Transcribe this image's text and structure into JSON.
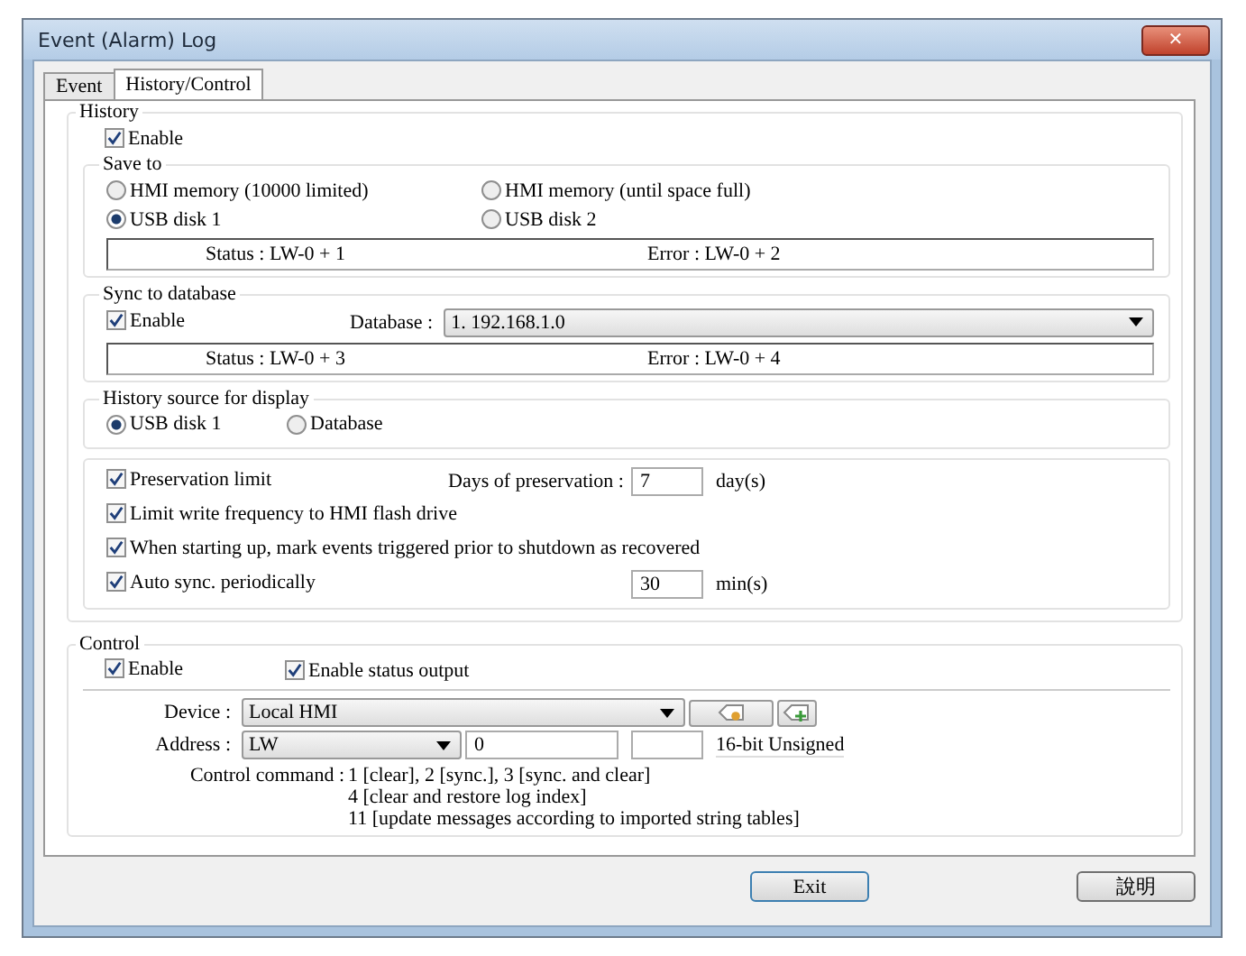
{
  "window": {
    "title": "Event (Alarm) Log",
    "close": "✕"
  },
  "tabs": [
    {
      "label": "Event",
      "selected": false
    },
    {
      "label": "History/Control",
      "selected": true
    }
  ],
  "history": {
    "title": "History",
    "enable": {
      "label": "Enable",
      "checked": true
    },
    "save_to": {
      "title": "Save to",
      "options": [
        {
          "label": "HMI memory (10000 limited)",
          "selected": false
        },
        {
          "label": "HMI memory (until space full)",
          "selected": false
        },
        {
          "label": "USB disk 1",
          "selected": true
        },
        {
          "label": "USB disk 2",
          "selected": false
        }
      ],
      "status": "Status : LW-0 + 1",
      "error": "Error : LW-0 + 2"
    },
    "sync": {
      "title": "Sync to database",
      "enable": {
        "label": "Enable",
        "checked": true
      },
      "database_label": "Database :",
      "database_value": "1. 192.168.1.0",
      "status": "Status : LW-0 + 3",
      "error": "Error : LW-0 + 4"
    },
    "source": {
      "title": "History source for display",
      "options": [
        {
          "label": "USB disk 1",
          "selected": true
        },
        {
          "label": "Database",
          "selected": false
        }
      ]
    },
    "options": [
      {
        "label": "Preservation limit",
        "checked": true,
        "field_label": "Days of preservation :",
        "value": "7",
        "unit": "day(s)"
      },
      {
        "label": "Limit write frequency to HMI flash drive",
        "checked": true
      },
      {
        "label": "When starting up, mark events triggered prior to shutdown as recovered",
        "checked": true
      },
      {
        "label": "Auto sync. periodically",
        "checked": true,
        "value": "30",
        "unit": "min(s)"
      }
    ]
  },
  "control": {
    "title": "Control",
    "enable": {
      "label": "Enable",
      "checked": true
    },
    "status_output": {
      "label": "Enable status output",
      "checked": true
    },
    "device_label": "Device :",
    "device_value": "Local HMI",
    "address_label": "Address :",
    "address_type": "LW",
    "address_value": "0",
    "data_format": "16-bit Unsigned",
    "command_label": "Control command :",
    "commands": [
      "1 [clear], 2 [sync.], 3 [sync. and clear]",
      "4 [clear and restore log index]",
      "11 [update messages according to imported string tables]"
    ]
  },
  "buttons": [
    {
      "label": "Exit",
      "default": true
    },
    {
      "label": "說明",
      "default": false
    }
  ]
}
